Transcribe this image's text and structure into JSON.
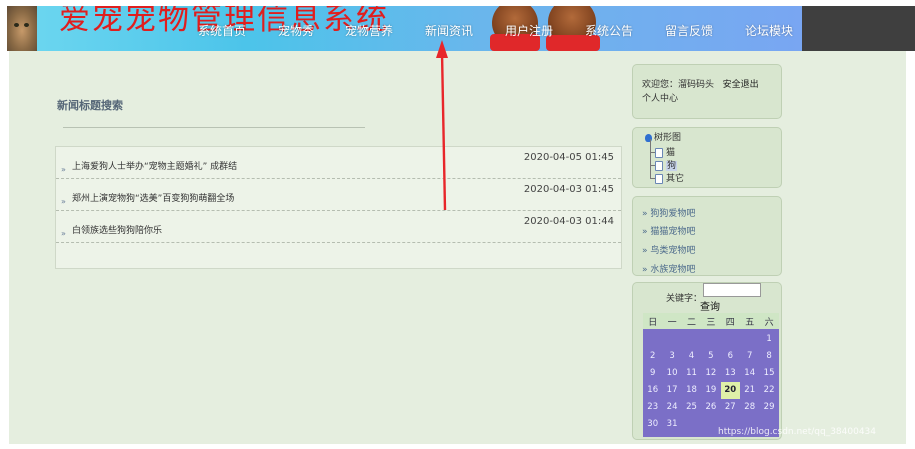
{
  "header": {
    "title": "爱宠宠物管理信息系统",
    "nav": [
      "系统首页",
      "宠物秀",
      "宠物营养",
      "新闻资讯",
      "用户注册",
      "系统公告",
      "留言反馈",
      "论坛模块"
    ]
  },
  "main": {
    "search_title": "新闻标题搜索",
    "news": [
      {
        "title": "上海爱狗人士举办“宠物主题婚礼” 成群结",
        "date": "2020-04-05 01:45"
      },
      {
        "title": "郑州上演宠物狗“选美”百变狗狗萌翻全场",
        "date": "2020-04-03 01:45"
      },
      {
        "title": "白领族选些狗狗陪你乐",
        "date": "2020-04-03 01:44"
      }
    ]
  },
  "sidebar": {
    "welcome": {
      "prefix": "欢迎您：",
      "user": "溜码码头",
      "logout": "安全退出",
      "center": "个人中心"
    },
    "tree": {
      "root": "树形图",
      "nodes": [
        "猫",
        "狗",
        "其它"
      ]
    },
    "categories": [
      "» 狗狗爱物吧",
      "» 猫猫宠物吧",
      "» 鸟类宠物吧",
      "» 水族宠物吧"
    ],
    "search": {
      "label": "关键字：",
      "button": "查询",
      "value": ""
    },
    "calendar": {
      "weekdays": [
        "日",
        "一",
        "二",
        "三",
        "四",
        "五",
        "六"
      ],
      "days": [
        "1",
        "2",
        "3",
        "4",
        "5",
        "6",
        "7",
        "8",
        "9",
        "10",
        "11",
        "12",
        "13",
        "14",
        "15",
        "16",
        "17",
        "18",
        "19",
        "20",
        "21",
        "22",
        "23",
        "24",
        "25",
        "26",
        "27",
        "28",
        "29",
        "30",
        "31"
      ],
      "first_weekday": 6,
      "today": "20"
    }
  },
  "watermark": "https://blog.csdn.net/qq_38400434",
  "colors": {
    "arrow": "#e8262a",
    "title": "#e01e1e",
    "calendar": "#7b6fc7"
  }
}
